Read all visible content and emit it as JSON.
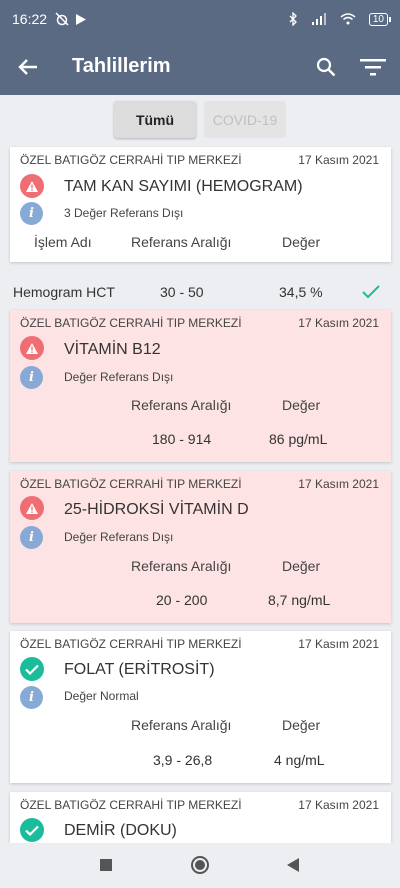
{
  "status_bar": {
    "time": "16:22",
    "battery": "10"
  },
  "app_bar": {
    "title": "Tahlillerim"
  },
  "tabs": [
    {
      "label": "Tümü",
      "active": true
    },
    {
      "label": "COVID-19",
      "active": false
    }
  ],
  "headers": {
    "islem": "İşlem Adı",
    "referans": "Referans Aralığı",
    "deger": "Değer"
  },
  "cards": [
    {
      "center": "ÖZEL BATIGÖZ CERRAHİ TIP MERKEZİ",
      "date": "17 Kasım 2021",
      "status": "warning",
      "name": "TAM KAN SAYIMI (HEMOGRAM)",
      "subtext": "3 Değer Referans Dışı"
    },
    {
      "center": "ÖZEL BATIGÖZ CERRAHİ TIP MERKEZİ",
      "date": "17 Kasım 2021",
      "status": "warning",
      "name": "VİTAMİN B12",
      "subtext": "Değer Referans Dışı",
      "range": "180 - 914",
      "value": "86 pg/mL"
    },
    {
      "center": "ÖZEL BATIGÖZ CERRAHİ TIP MERKEZİ",
      "date": "17 Kasım 2021",
      "status": "warning",
      "name": "25-HİDROKSİ VİTAMİN D",
      "subtext": "Değer Referans Dışı",
      "range": "20 - 200",
      "value": "8,7 ng/mL"
    },
    {
      "center": "ÖZEL BATIGÖZ CERRAHİ TIP MERKEZİ",
      "date": "17 Kasım 2021",
      "status": "ok",
      "name": "FOLAT (ERİTROSİT)",
      "subtext": "Değer Normal",
      "range": "3,9 - 26,8",
      "value": "4 ng/mL"
    },
    {
      "center": "ÖZEL BATIGÖZ CERRAHİ TIP MERKEZİ",
      "date": "17 Kasım 2021",
      "status": "ok",
      "name": "DEMİR (DOKU)"
    }
  ],
  "hemogram_row": {
    "name": "Hemogram HCT",
    "range": "30 - 50",
    "value": "34,5 %"
  },
  "colors": {
    "app_bar": "#5a6a83",
    "alert_bg": "#fde3e4",
    "warning": "#ee6e73",
    "ok": "#1bbc9b",
    "info": "#87a9d6"
  }
}
